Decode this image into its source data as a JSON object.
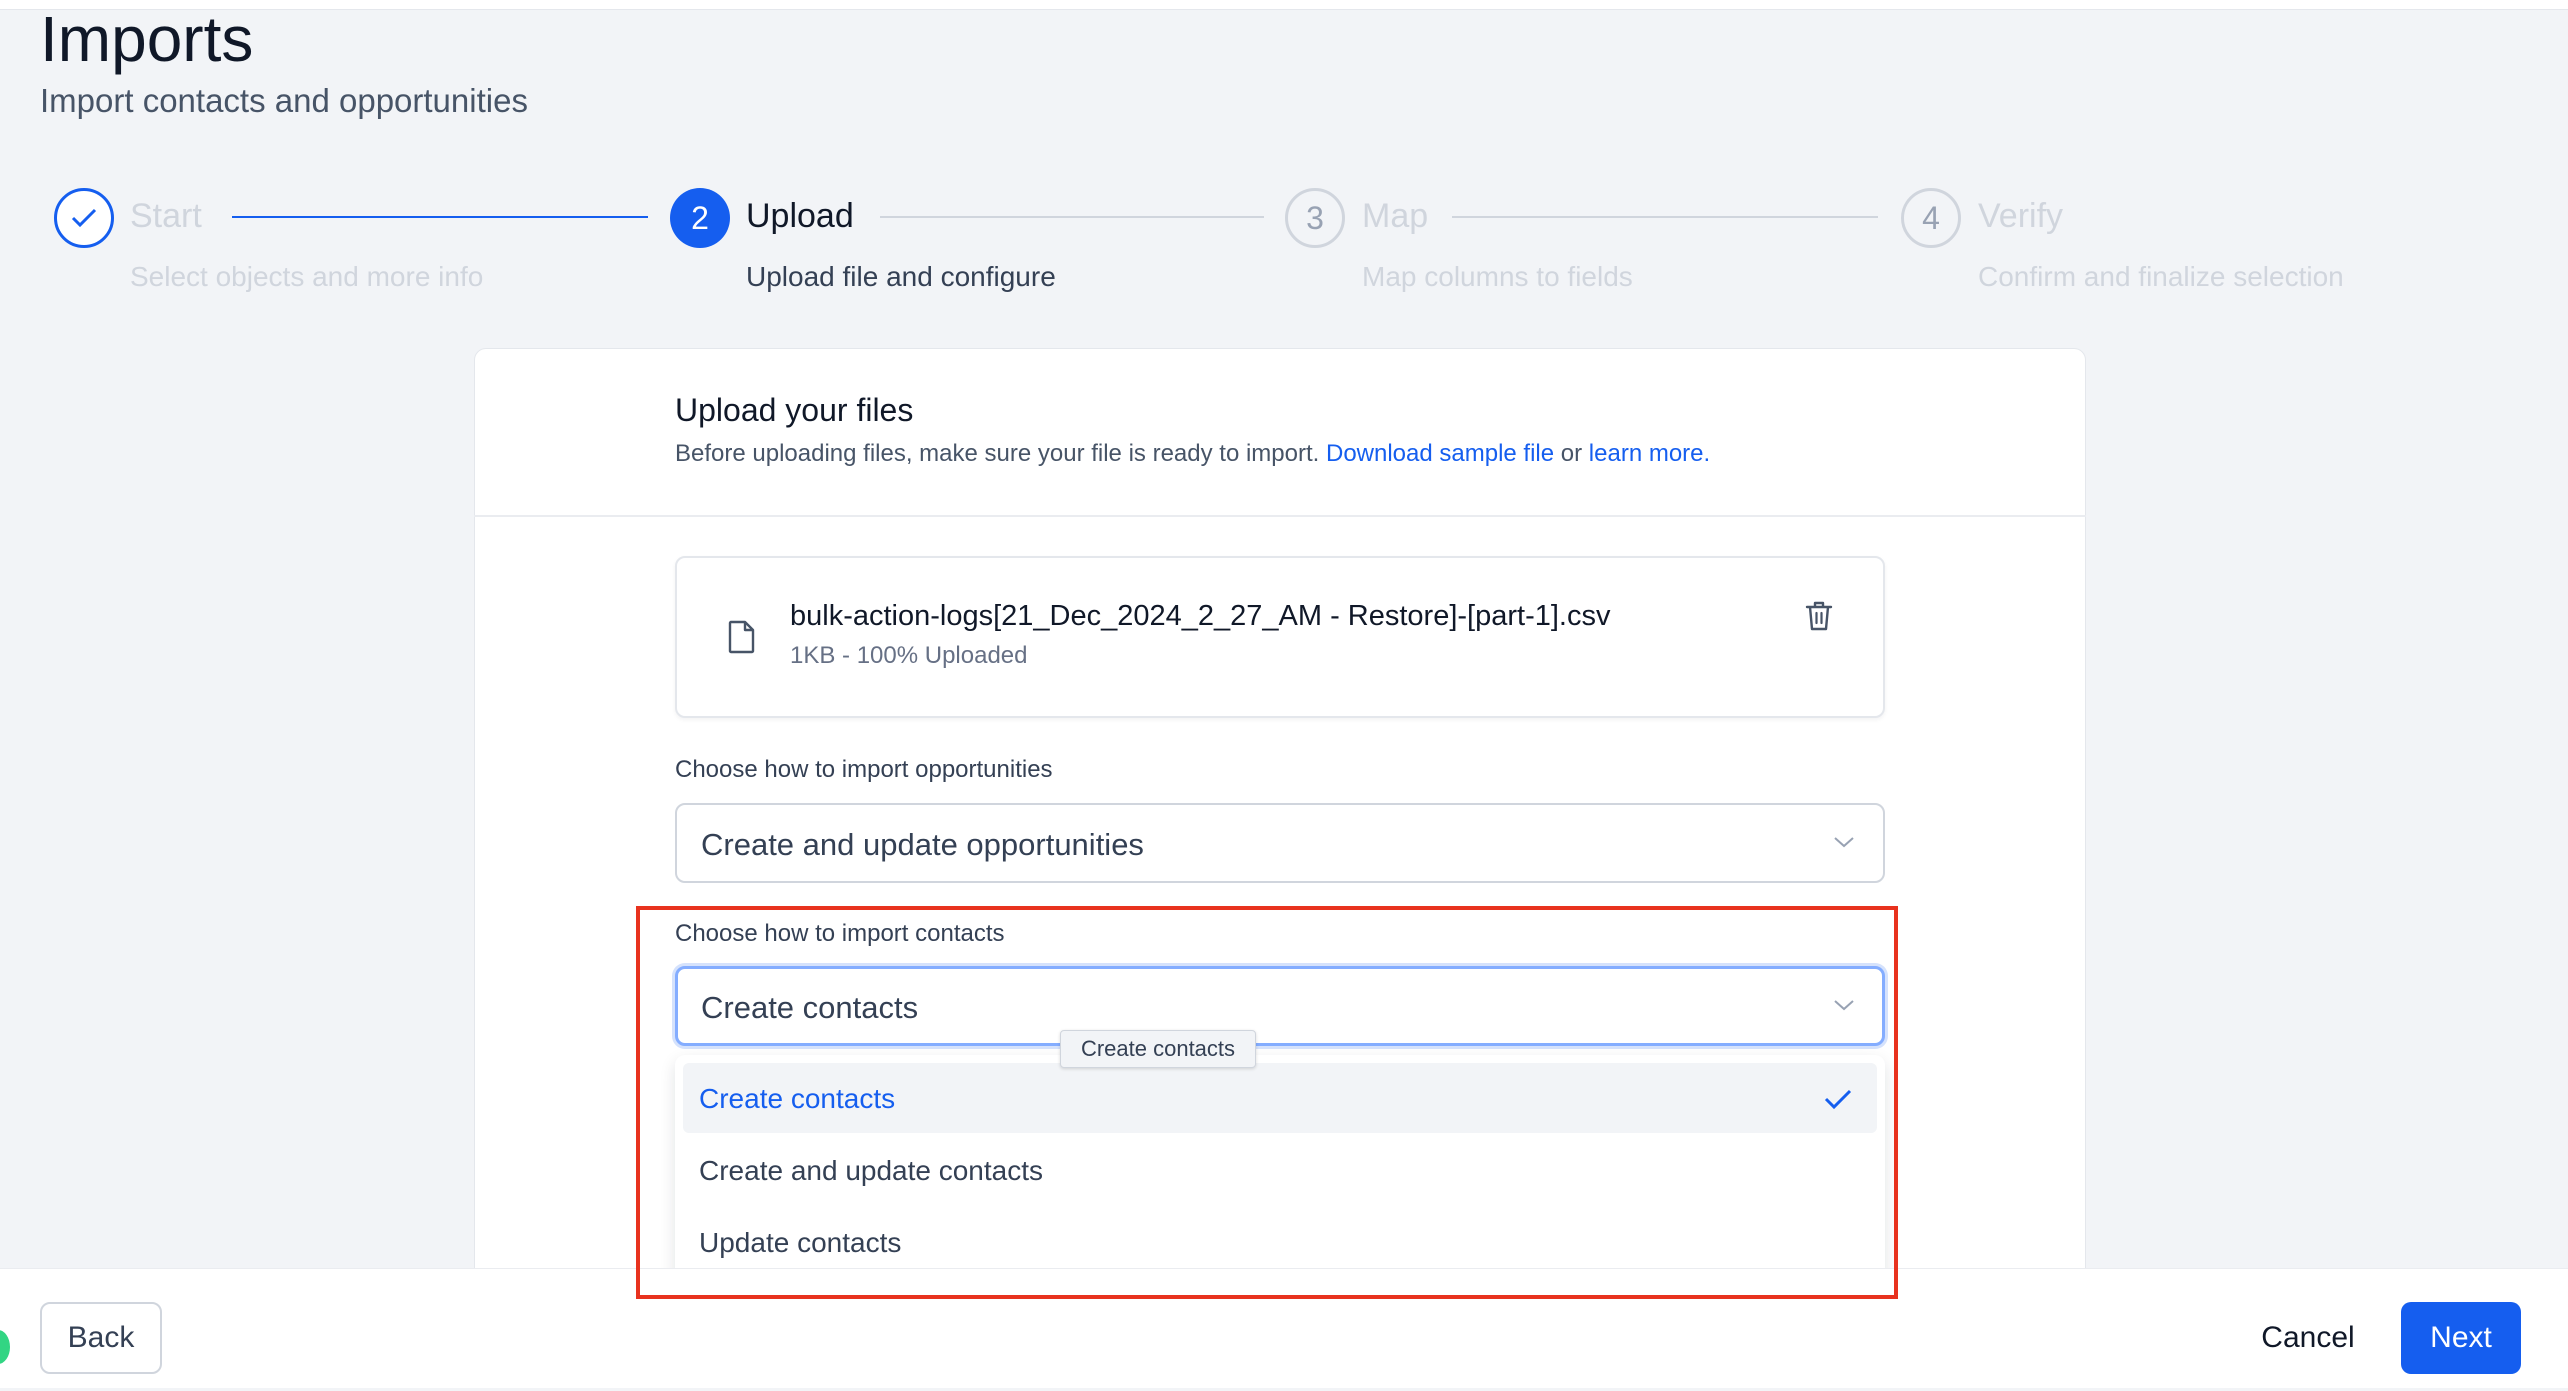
{
  "header": {
    "title": "Imports",
    "subtitle": "Import contacts and opportunities"
  },
  "steps": [
    {
      "number": "1",
      "title": "Start",
      "description": "Select objects and more info",
      "state": "completed"
    },
    {
      "number": "2",
      "title": "Upload",
      "description": "Upload file and configure",
      "state": "active"
    },
    {
      "number": "3",
      "title": "Map",
      "description": "Map columns to fields",
      "state": "upcoming"
    },
    {
      "number": "4",
      "title": "Verify",
      "description": "Confirm and finalize selection",
      "state": "upcoming"
    }
  ],
  "upload": {
    "title": "Upload your files",
    "description": "Before uploading files, make sure your file is ready to import.",
    "download_link": "Download sample file",
    "or_text": "or",
    "learn_link": "learn more."
  },
  "file": {
    "name": "bulk-action-logs[21_Dec_2024_2_27_AM - Restore]-[part-1].csv",
    "meta": "1KB - 100% Uploaded"
  },
  "opportunities": {
    "label": "Choose how to import opportunities",
    "selected": "Create and update opportunities"
  },
  "contacts": {
    "label": "Choose how to import contacts",
    "selected": "Create contacts",
    "tooltip": "Create contacts",
    "options": [
      "Create contacts",
      "Create and update contacts",
      "Update contacts"
    ]
  },
  "footer": {
    "back": "Back",
    "cancel": "Cancel",
    "next": "Next"
  },
  "colors": {
    "primary": "#155eef",
    "highlight": "#e8321e",
    "status": "#32d583"
  },
  "icons": [
    "check-icon",
    "file-icon",
    "trash-icon",
    "chevron-down-icon"
  ]
}
